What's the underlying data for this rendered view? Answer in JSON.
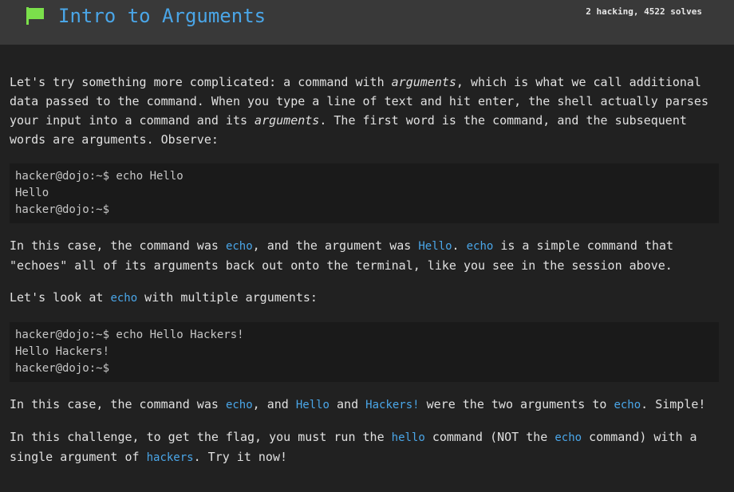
{
  "header": {
    "title": "Intro to Arguments",
    "stats": "2 hacking, 4522 solves",
    "flag_icon_color": "#7be04b",
    "accent_color": "#4aa6e8"
  },
  "content": {
    "p1": {
      "a": "Let's try something more complicated: a command with ",
      "b": "arguments",
      "c": ", which is what we call additional data passed to the command. When you type a line of text and hit enter, the shell actually parses your input into a command and its ",
      "d": "arguments",
      "e": ". The first word is the command, and the subsequent words are arguments. Observe:"
    },
    "code1": [
      "hacker@dojo:~$ echo Hello",
      "Hello",
      "hacker@dojo:~$"
    ],
    "p2": {
      "a": "In this case, the command was ",
      "b": "echo",
      "c": ", and the argument was ",
      "d": "Hello",
      "e": ". ",
      "f": "echo",
      "g": " is a simple command that \"echoes\" all of its arguments back out onto the terminal, like you see in the session above."
    },
    "p3": {
      "a": "Let's look at ",
      "b": "echo",
      "c": " with multiple arguments:"
    },
    "code2": [
      "hacker@dojo:~$ echo Hello Hackers!",
      "Hello Hackers!",
      "hacker@dojo:~$"
    ],
    "p4": {
      "a": "In this case, the command was ",
      "b": "echo",
      "c": ", and ",
      "d": "Hello",
      "e": " and ",
      "f": "Hackers!",
      "g": " were the two arguments to ",
      "h": "echo",
      "i": ". Simple!"
    },
    "p5": {
      "a": "In this challenge, to get the flag, you must run the ",
      "b": "hello",
      "c": " command (NOT the ",
      "d": "echo",
      "e": " command) with a single argument of ",
      "f": "hackers",
      "g": ". Try it now!"
    }
  }
}
